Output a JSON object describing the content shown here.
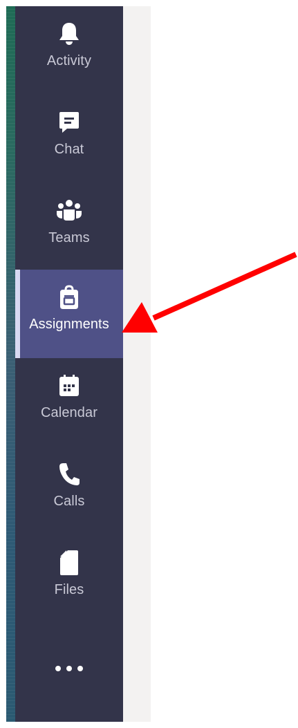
{
  "nav": {
    "items": [
      {
        "label": "Activity",
        "icon": "bell-icon"
      },
      {
        "label": "Chat",
        "icon": "chat-icon"
      },
      {
        "label": "Teams",
        "icon": "teams-icon"
      },
      {
        "label": "Assignments",
        "icon": "backpack-icon",
        "active": true
      },
      {
        "label": "Calendar",
        "icon": "calendar-icon"
      },
      {
        "label": "Calls",
        "icon": "phone-icon"
      },
      {
        "label": "Files",
        "icon": "file-icon"
      }
    ],
    "more_icon": "more-icon"
  },
  "colors": {
    "rail_bg": "#33344a",
    "active_bg": "#4f5187",
    "active_indicator": "#d8d9f2",
    "annotation_arrow": "#ff0000"
  }
}
